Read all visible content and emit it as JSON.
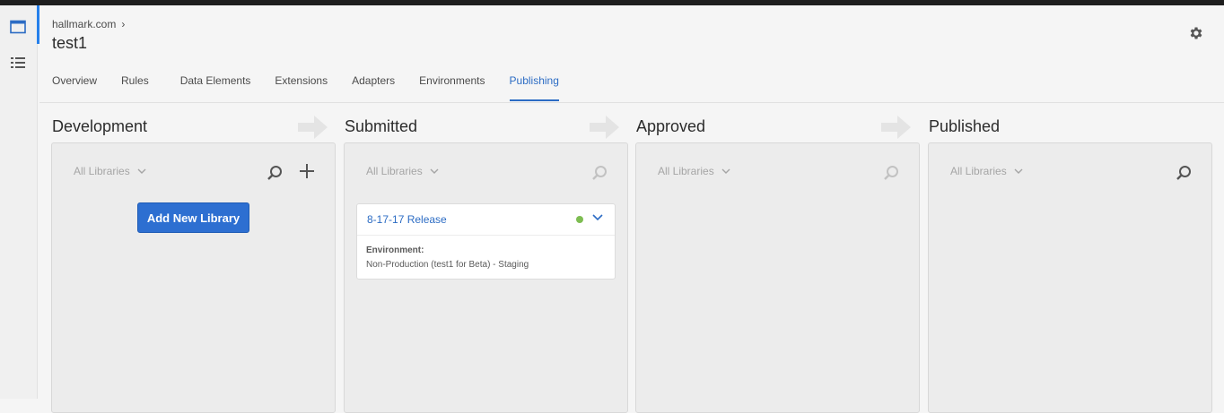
{
  "breadcrumb": {
    "parent": "hallmark.com"
  },
  "page_title": "test1",
  "tabs": [
    {
      "label": "Overview"
    },
    {
      "label": "Rules"
    },
    {
      "label": "Data Elements"
    },
    {
      "label": "Extensions"
    },
    {
      "label": "Adapters"
    },
    {
      "label": "Environments"
    },
    {
      "label": "Publishing",
      "active": true
    }
  ],
  "columns": [
    {
      "title": "Development",
      "filter": "All Libraries",
      "add_button": "Add New Library"
    },
    {
      "title": "Submitted",
      "filter": "All Libraries",
      "card": {
        "title": "8-17-17 Release",
        "environment_label": "Environment:",
        "environment_value": "Non-Production (test1 for Beta) - Staging",
        "status_color": "#7ebd52"
      }
    },
    {
      "title": "Approved",
      "filter": "All Libraries"
    },
    {
      "title": "Published",
      "filter": "All Libraries"
    }
  ],
  "icons": [
    "window-icon",
    "list-icon",
    "gear-icon",
    "search-icon",
    "plus-icon",
    "chevron-down-icon",
    "arrow-right-icon"
  ],
  "colors": {
    "accent": "#2c6cc4",
    "button": "#2d6fd1",
    "status_ok": "#7ebd52"
  }
}
